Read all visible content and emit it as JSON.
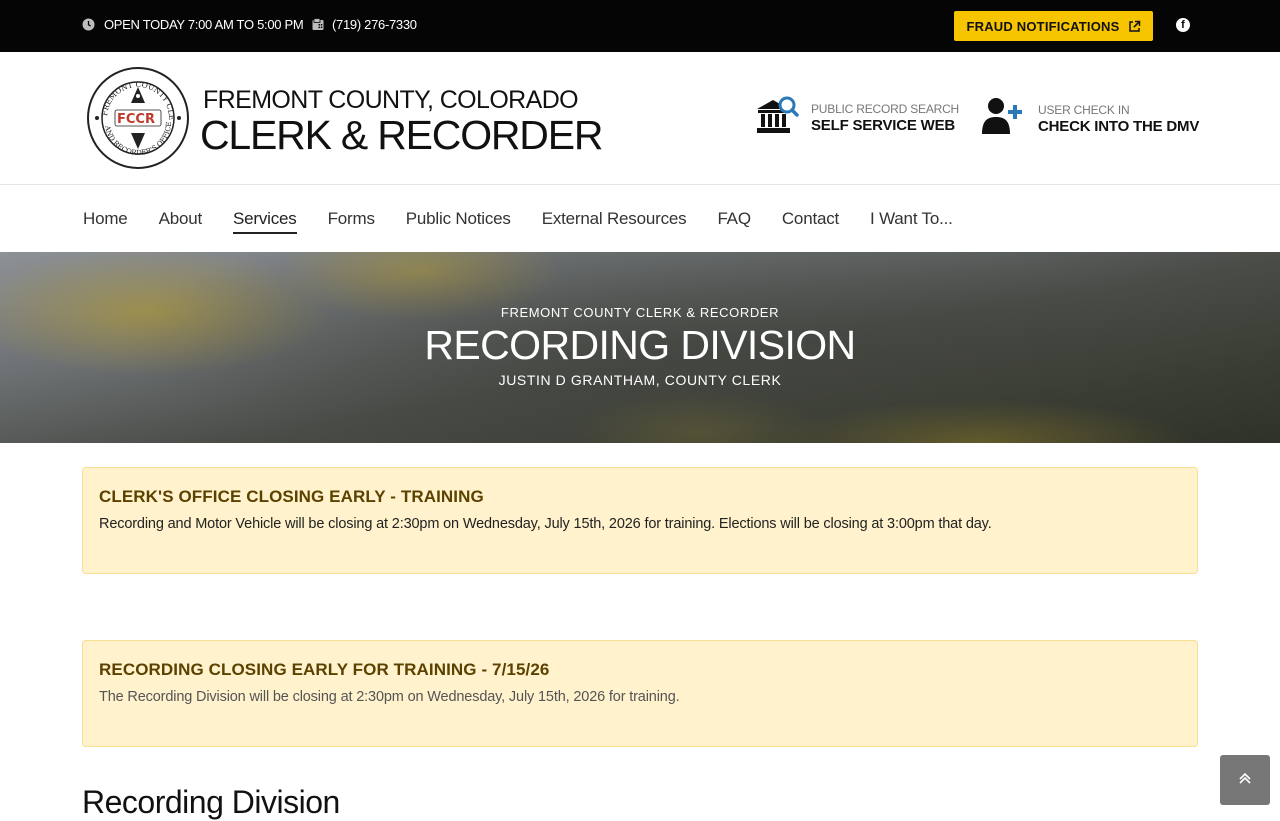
{
  "topbar": {
    "hours": "OPEN TODAY 7:00 AM TO 5:00 PM",
    "phone": "(719) 276-7330",
    "fraud_button": "FRAUD NOTIFICATIONS",
    "fraud_button_color": "#f7c400",
    "social_icon": "facebook-icon"
  },
  "header": {
    "logo_text": "FCCR",
    "brand_line1": "FREMONT COUNTY, COLORADO",
    "brand_line2": "CLERK & RECORDER",
    "links": [
      {
        "small": "PUBLIC RECORD SEARCH",
        "big": "SELF SERVICE WEB",
        "icon": "bank-search-icon"
      },
      {
        "small": "USER CHECK IN",
        "big": "CHECK INTO THE DMV",
        "icon": "user-add-icon"
      }
    ]
  },
  "nav": {
    "items": [
      "Home",
      "About",
      "Services",
      "Forms",
      "Public Notices",
      "External Resources",
      "FAQ",
      "Contact",
      "I Want To..."
    ],
    "active": "Services"
  },
  "hero": {
    "kicker": "FREMONT COUNTY CLERK & RECORDER",
    "title": "RECORDING DIVISION",
    "subtitle": "JUSTIN D GRANTHAM, COUNTY CLERK"
  },
  "alerts": [
    {
      "title": "CLERK'S OFFICE CLOSING EARLY - TRAINING",
      "body": "Recording and Motor Vehicle will be closing at 2:30pm on Wednesday, July 15th, 2026 for training.  Elections will be closing at 3:00pm that day."
    },
    {
      "title": "RECORDING CLOSING EARLY FOR TRAINING - 7/15/26",
      "body": "The Recording Division will be closing at 2:30pm on Wednesday, July 15th, 2026 for training."
    }
  ],
  "section_title": "Recording Division",
  "colors": {
    "alert_bg": "#fff2cc",
    "alert_title": "#5c4200",
    "link_icon_accent": "#2b78b8"
  }
}
